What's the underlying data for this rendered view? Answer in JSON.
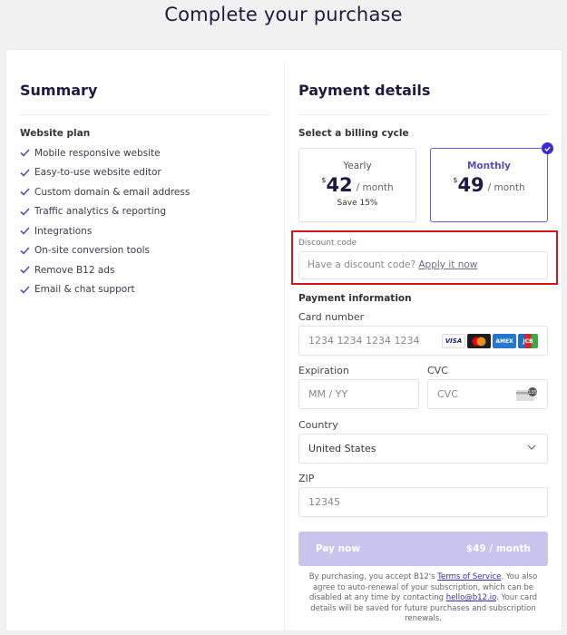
{
  "page": {
    "title": "Complete your purchase"
  },
  "summary": {
    "title": "Summary",
    "plan_title": "Website plan",
    "features": [
      "Mobile responsive website",
      "Easy-to-use website editor",
      "Custom domain & email address",
      "Traffic analytics & reporting",
      "Integrations",
      "On-site conversion tools",
      "Remove B12 ads",
      "Email & chat support"
    ]
  },
  "payment": {
    "title": "Payment details",
    "billing_cycle_label": "Select a billing cycle",
    "cycles": [
      {
        "name": "Yearly",
        "currency": "$",
        "amount": "42",
        "per": "/ month",
        "note": "Save 15%",
        "selected": false
      },
      {
        "name": "Monthly",
        "currency": "$",
        "amount": "49",
        "per": "/ month",
        "note": "",
        "selected": true
      }
    ],
    "discount": {
      "label": "Discount code",
      "prompt": "Have a discount code?",
      "link": "Apply it now"
    },
    "info_title": "Payment information",
    "card_number": {
      "label": "Card number",
      "placeholder": "1234 1234 1234 1234",
      "brands": [
        "VISA",
        "Mastercard",
        "Amex",
        "JCB"
      ]
    },
    "expiration": {
      "label": "Expiration",
      "placeholder": "MM / YY"
    },
    "cvc": {
      "label": "CVC",
      "placeholder": "CVC"
    },
    "country": {
      "label": "Country",
      "value": "United States"
    },
    "zip": {
      "label": "ZIP",
      "placeholder": "12345"
    },
    "pay_button": {
      "label": "Pay now",
      "amount": "$49 / month"
    },
    "legal": {
      "part1": "By purchasing, you accept B12's ",
      "tos_link": "Terms of Service",
      "part2": ". You also agree to auto-renewal of your subscription, which can be disabled at any time by contacting ",
      "email_link": "hello@b12.io",
      "part3": ". Your card details will be saved for future purchases and subscription renewals."
    }
  },
  "colors": {
    "accent": "#5b4bb6",
    "badge": "#3c2ad4",
    "pay_button_disabled": "#c8c4ec",
    "highlight_border": "#d8141b"
  }
}
